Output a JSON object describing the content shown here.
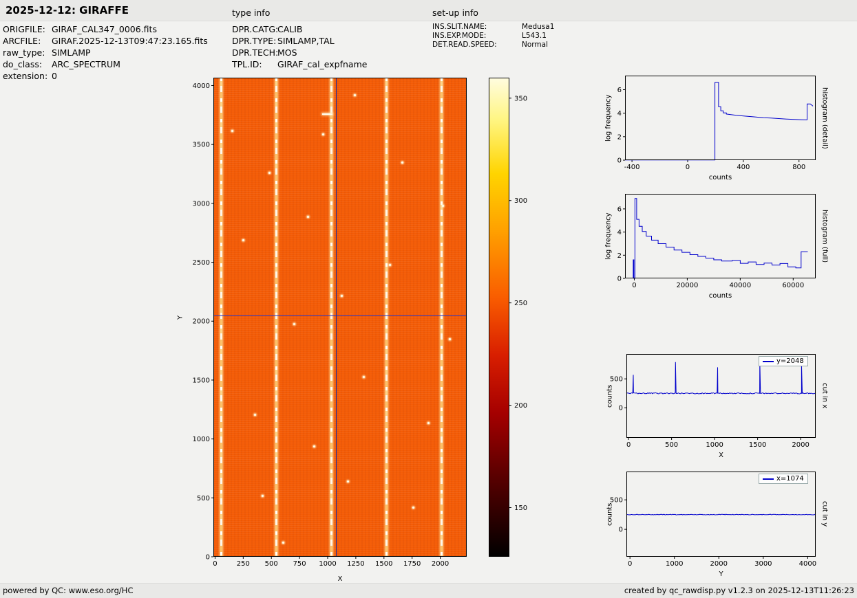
{
  "header": {
    "title": "2025-12-12: GIRAFFE",
    "type_info": "type info",
    "setup_info": "set-up info"
  },
  "metadata": {
    "rows": [
      {
        "label": "ORIGFILE:",
        "value": "GIRAF_CAL347_0006.fits"
      },
      {
        "label": "ARCFILE:",
        "value": "GIRAF.2025-12-13T09:47:23.165.fits"
      },
      {
        "label": "raw_type:",
        "value": "SIMLAMP"
      },
      {
        "label": "do_class:",
        "value": "ARC_SPECTRUM"
      },
      {
        "label": "extension:",
        "value": "0"
      }
    ]
  },
  "type_info": {
    "rows": [
      {
        "label": "DPR.CATG:",
        "value": "CALIB"
      },
      {
        "label": "DPR.TYPE:",
        "value": "SIMLAMP,TAL"
      },
      {
        "label": "DPR.TECH:",
        "value": "MOS"
      },
      {
        "label": "TPL.ID:",
        "value": "GIRAF_cal_expfname"
      }
    ]
  },
  "setup_info": {
    "rows": [
      {
        "label": "INS.SLIT.NAME:",
        "value": "Medusa1"
      },
      {
        "label": "INS.EXP.MODE:",
        "value": "L543.1"
      },
      {
        "label": "DET.READ.SPEED:",
        "value": "Normal"
      }
    ]
  },
  "footer": {
    "left": "powered by QC: www.eso.org/HC",
    "right": "created by qc_rawdisp.py v1.2.3 on 2025-12-13T11:26:23"
  },
  "colors": {
    "accent_line": "#0000cc",
    "crosshair": "#2230c8",
    "image_base": "#f45c06"
  },
  "chart_data": [
    {
      "type": "heatmap",
      "name": "raw-image",
      "xlabel": "X",
      "ylabel": "Y",
      "xlim": [
        -15,
        2235
      ],
      "ylim": [
        0,
        4067
      ],
      "xticks": [
        0,
        250,
        500,
        750,
        1000,
        1250,
        1500,
        1750,
        2000
      ],
      "yticks": [
        0,
        500,
        1000,
        1500,
        2000,
        2500,
        3000,
        3500,
        4000
      ],
      "arc_lines_x": [
        55,
        545,
        1035,
        1525,
        2010
      ],
      "crosshair": {
        "x": 1074,
        "y": 2048
      },
      "speckles": [
        [
          150,
          3620
        ],
        [
          350,
          1210
        ],
        [
          820,
          2890
        ],
        [
          1180,
          640
        ],
        [
          1660,
          3350
        ],
        [
          700,
          1980
        ],
        [
          1890,
          1140
        ],
        [
          420,
          520
        ],
        [
          960,
          3590
        ],
        [
          1550,
          2480
        ],
        [
          250,
          2690
        ],
        [
          1320,
          1530
        ],
        [
          1760,
          420
        ],
        [
          880,
          940
        ],
        [
          1120,
          2220
        ],
        [
          480,
          3260
        ],
        [
          2020,
          2980
        ],
        [
          1240,
          3920
        ],
        [
          600,
          120
        ],
        [
          2080,
          1850
        ]
      ],
      "streak": [
        995,
        3760
      ],
      "colormap": "hot",
      "mean_counts": 250
    },
    {
      "type": "colorbar",
      "name": "colorbar",
      "ticks": [
        150,
        200,
        250,
        300,
        350
      ],
      "vmin": 126,
      "vmax": 360,
      "colormap": "hot"
    },
    {
      "type": "line",
      "name": "histogram-detail",
      "xlabel": "counts",
      "ylabel": "log frequency",
      "right_label": "histogram (detail)",
      "xlim": [
        -450,
        920
      ],
      "ylim": [
        0,
        7.2
      ],
      "xticks": [
        -400,
        0,
        400,
        800
      ],
      "yticks": [
        0,
        2,
        4,
        6
      ],
      "points": [
        [
          -450,
          0.02
        ],
        [
          196,
          0.02
        ],
        [
          196,
          6.62
        ],
        [
          222,
          6.62
        ],
        [
          222,
          4.55
        ],
        [
          238,
          4.55
        ],
        [
          238,
          4.2
        ],
        [
          256,
          4.2
        ],
        [
          256,
          4.02
        ],
        [
          278,
          4.02
        ],
        [
          278,
          3.93
        ],
        [
          310,
          3.88
        ],
        [
          350,
          3.82
        ],
        [
          395,
          3.77
        ],
        [
          440,
          3.72
        ],
        [
          490,
          3.67
        ],
        [
          545,
          3.62
        ],
        [
          600,
          3.58
        ],
        [
          655,
          3.54
        ],
        [
          710,
          3.5
        ],
        [
          765,
          3.47
        ],
        [
          820,
          3.44
        ],
        [
          858,
          3.43
        ],
        [
          858,
          4.78
        ],
        [
          882,
          4.78
        ],
        [
          900,
          4.6
        ]
      ]
    },
    {
      "type": "line",
      "name": "histogram-full",
      "xlabel": "counts",
      "ylabel": "log frequency",
      "right_label": "histogram (full)",
      "xlim": [
        -3500,
        68500
      ],
      "ylim": [
        0,
        7.3
      ],
      "xticks": [
        0,
        20000,
        40000,
        60000
      ],
      "yticks": [
        0,
        2,
        4,
        6
      ],
      "points": [
        [
          -400,
          0
        ],
        [
          -400,
          1.6
        ],
        [
          -150,
          1.6
        ],
        [
          -150,
          0
        ],
        [
          250,
          0
        ],
        [
          250,
          6.9
        ],
        [
          900,
          6.9
        ],
        [
          900,
          5.1
        ],
        [
          1800,
          5.1
        ],
        [
          1800,
          4.5
        ],
        [
          3000,
          4.5
        ],
        [
          3000,
          4.05
        ],
        [
          4500,
          4.05
        ],
        [
          4500,
          3.65
        ],
        [
          6500,
          3.65
        ],
        [
          6500,
          3.3
        ],
        [
          9000,
          3.3
        ],
        [
          9000,
          3.0
        ],
        [
          12000,
          3.0
        ],
        [
          12000,
          2.7
        ],
        [
          15000,
          2.7
        ],
        [
          15000,
          2.45
        ],
        [
          18000,
          2.45
        ],
        [
          18000,
          2.25
        ],
        [
          21000,
          2.25
        ],
        [
          21000,
          2.05
        ],
        [
          24000,
          2.05
        ],
        [
          24000,
          1.9
        ],
        [
          27000,
          1.9
        ],
        [
          27000,
          1.75
        ],
        [
          30000,
          1.75
        ],
        [
          30000,
          1.6
        ],
        [
          33000,
          1.6
        ],
        [
          33000,
          1.5
        ],
        [
          37000,
          1.5
        ],
        [
          37000,
          1.55
        ],
        [
          40000,
          1.55
        ],
        [
          40000,
          1.3
        ],
        [
          43000,
          1.3
        ],
        [
          43000,
          1.42
        ],
        [
          46000,
          1.42
        ],
        [
          46000,
          1.2
        ],
        [
          49000,
          1.2
        ],
        [
          49000,
          1.32
        ],
        [
          52000,
          1.32
        ],
        [
          52000,
          1.15
        ],
        [
          55000,
          1.15
        ],
        [
          55000,
          1.28
        ],
        [
          58000,
          1.28
        ],
        [
          58000,
          1.0
        ],
        [
          61000,
          1.0
        ],
        [
          61000,
          0.9
        ],
        [
          63000,
          0.9
        ],
        [
          63000,
          2.3
        ],
        [
          65500,
          2.3
        ]
      ]
    },
    {
      "type": "line",
      "name": "cut-in-x",
      "legend": "y=2048",
      "xlabel": "X",
      "ylabel": "counts",
      "right_label": "cut in x",
      "xlim": [
        -25,
        2175
      ],
      "ylim": [
        -520,
        930
      ],
      "xticks": [
        0,
        500,
        1000,
        1500,
        2000
      ],
      "yticks": [
        0,
        500
      ],
      "baseline": 250,
      "noise": 18,
      "spikes": [
        [
          55,
          570
        ],
        [
          545,
          790
        ],
        [
          1035,
          700
        ],
        [
          1525,
          810
        ],
        [
          2010,
          760
        ]
      ]
    },
    {
      "type": "line",
      "name": "cut-in-y",
      "legend": "x=1074",
      "xlabel": "Y",
      "ylabel": "counts",
      "right_label": "cut in y",
      "xlim": [
        -80,
        4180
      ],
      "ylim": [
        -465,
        980
      ],
      "xticks": [
        0,
        1000,
        2000,
        3000,
        4000
      ],
      "yticks": [
        0,
        500
      ],
      "baseline": 250,
      "noise": 10,
      "spikes": []
    }
  ]
}
